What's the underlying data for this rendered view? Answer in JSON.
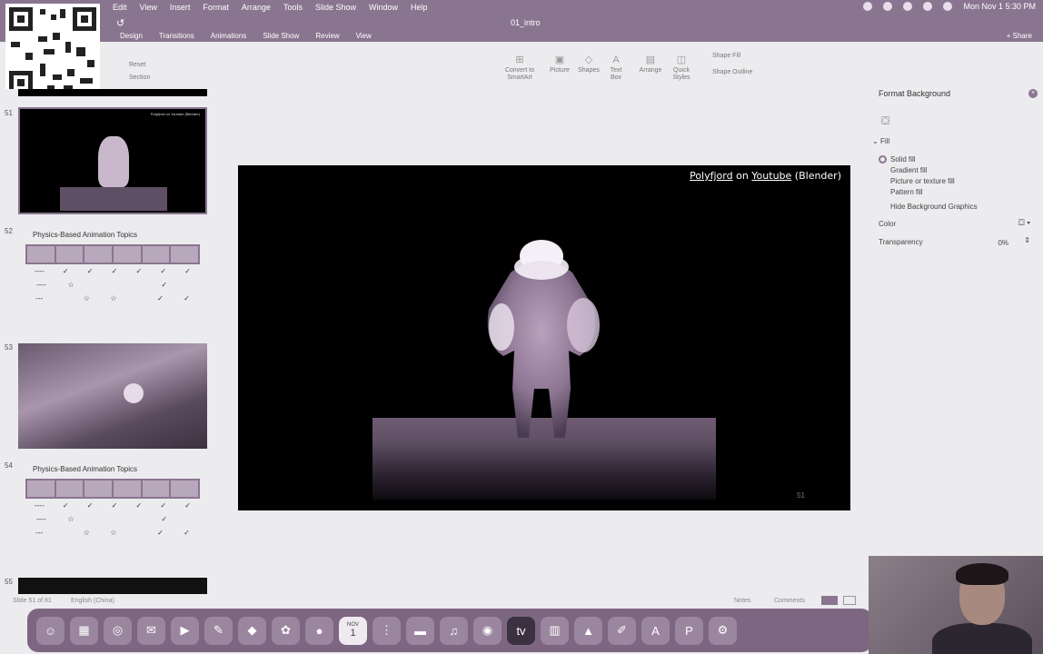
{
  "menu_bar": {
    "items": [
      "Edit",
      "View",
      "Insert",
      "Format",
      "Arrange",
      "Tools",
      "Slide Show",
      "Window",
      "Help"
    ],
    "clock": "Mon Nov 1  5:30 PM"
  },
  "ribbon": {
    "document_title": "01_intro",
    "tabs": [
      "Design",
      "Transitions",
      "Animations",
      "Slide Show",
      "Review",
      "View"
    ],
    "share_label": "Share",
    "reset_label": "Reset",
    "section_label": "Section",
    "tools": [
      "Convert to SmartArt",
      "Picture",
      "Shapes",
      "Text Box",
      "Arrange",
      "Quick Styles",
      "Shape Fill",
      "Shape Outline"
    ]
  },
  "thumbnails": [
    {
      "num": "51",
      "title": "Polyfjord on Youtube (Blender)"
    },
    {
      "num": "52",
      "title": "Physics-Based Animation Topics"
    },
    {
      "num": "53",
      "title": ""
    },
    {
      "num": "54",
      "title": "Physics-Based Animation Topics"
    },
    {
      "num": "55",
      "title": ""
    }
  ],
  "mini_table_rows": [
    [
      "----",
      "✓",
      "✓",
      "✓",
      "✓",
      "✓",
      "✓"
    ],
    [
      "----",
      "☆",
      "",
      "",
      "",
      "✓",
      ""
    ],
    [
      "---",
      "",
      "☆",
      "☆",
      "",
      "✓",
      "✓"
    ]
  ],
  "slide": {
    "credit_link1": "Polyfjord",
    "credit_on": " on ",
    "credit_link2": "Youtube",
    "credit_suffix": " (Blender)",
    "number": "51"
  },
  "format_pane": {
    "title": "Format Background",
    "fill_label": "Fill",
    "options": [
      "Solid fill",
      "Gradient fill",
      "Picture or texture fill",
      "Pattern fill",
      "Hide Background Graphics"
    ],
    "color_label": "Color",
    "transparency_label": "Transparency",
    "transparency_value": "0%"
  },
  "status_bar": {
    "slide_info": "Slide 51 of 81",
    "language": "English (China)",
    "notes_label": "Notes",
    "comments_label": "Comments"
  },
  "dock": {
    "calendar_month": "NOV",
    "calendar_day": "1",
    "icons": [
      "finder-icon",
      "launchpad-icon",
      "safari-icon",
      "mail-icon",
      "facetime-icon",
      "messages-icon",
      "maps-icon",
      "photos-icon",
      "contacts-icon",
      "calendar-icon",
      "reminders-icon",
      "notes-icon",
      "music-icon",
      "podcasts-icon",
      "tv-icon",
      "numbers-icon",
      "keynote-icon",
      "pages-icon",
      "appstore-icon",
      "preferences-icon",
      "powerpoint-icon"
    ]
  },
  "colors": {
    "accent": "#8a7590",
    "slide_background": "#000000"
  }
}
